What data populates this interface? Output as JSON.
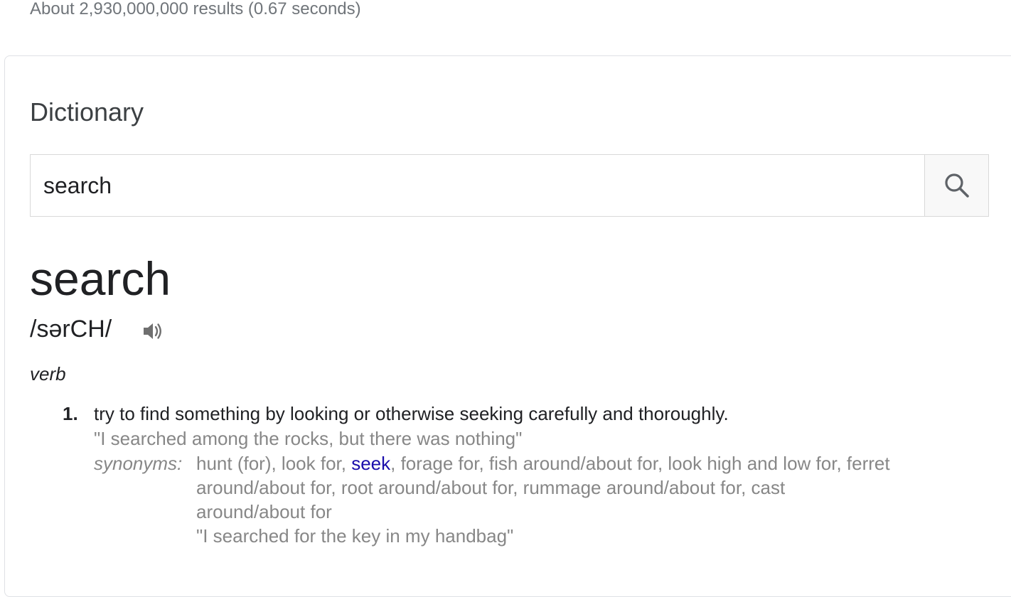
{
  "result_stats": "About 2,930,000,000 results (0.67 seconds)",
  "section_title": "Dictionary",
  "search": {
    "value": "search",
    "button_icon": "search-icon"
  },
  "entry": {
    "headword": "search",
    "phonetic": "/sərCH/",
    "audio_icon": "speaker-icon",
    "part_of_speech": "verb",
    "senses": [
      {
        "number": "1.",
        "definition": "try to find something by looking or otherwise seeking carefully and thoroughly.",
        "example": "\"I searched among the rocks, but there was nothing\"",
        "synonyms_label": "synonyms:",
        "synonyms_line1_before": "hunt (for), look for, ",
        "synonyms_link": "seek",
        "synonyms_line1_after": ", forage for, fish around/about for, look high and low for, ferret",
        "synonyms_line2": "around/about for, root around/about for, rummage around/about for, cast",
        "synonyms_line3": "around/about for",
        "synonyms_example": "\"I searched for the key in my handbag\""
      }
    ]
  },
  "colors": {
    "link": "#1a0dab",
    "muted_text": "#878787",
    "primary_text": "#202124",
    "border": "#dfe1e5"
  }
}
